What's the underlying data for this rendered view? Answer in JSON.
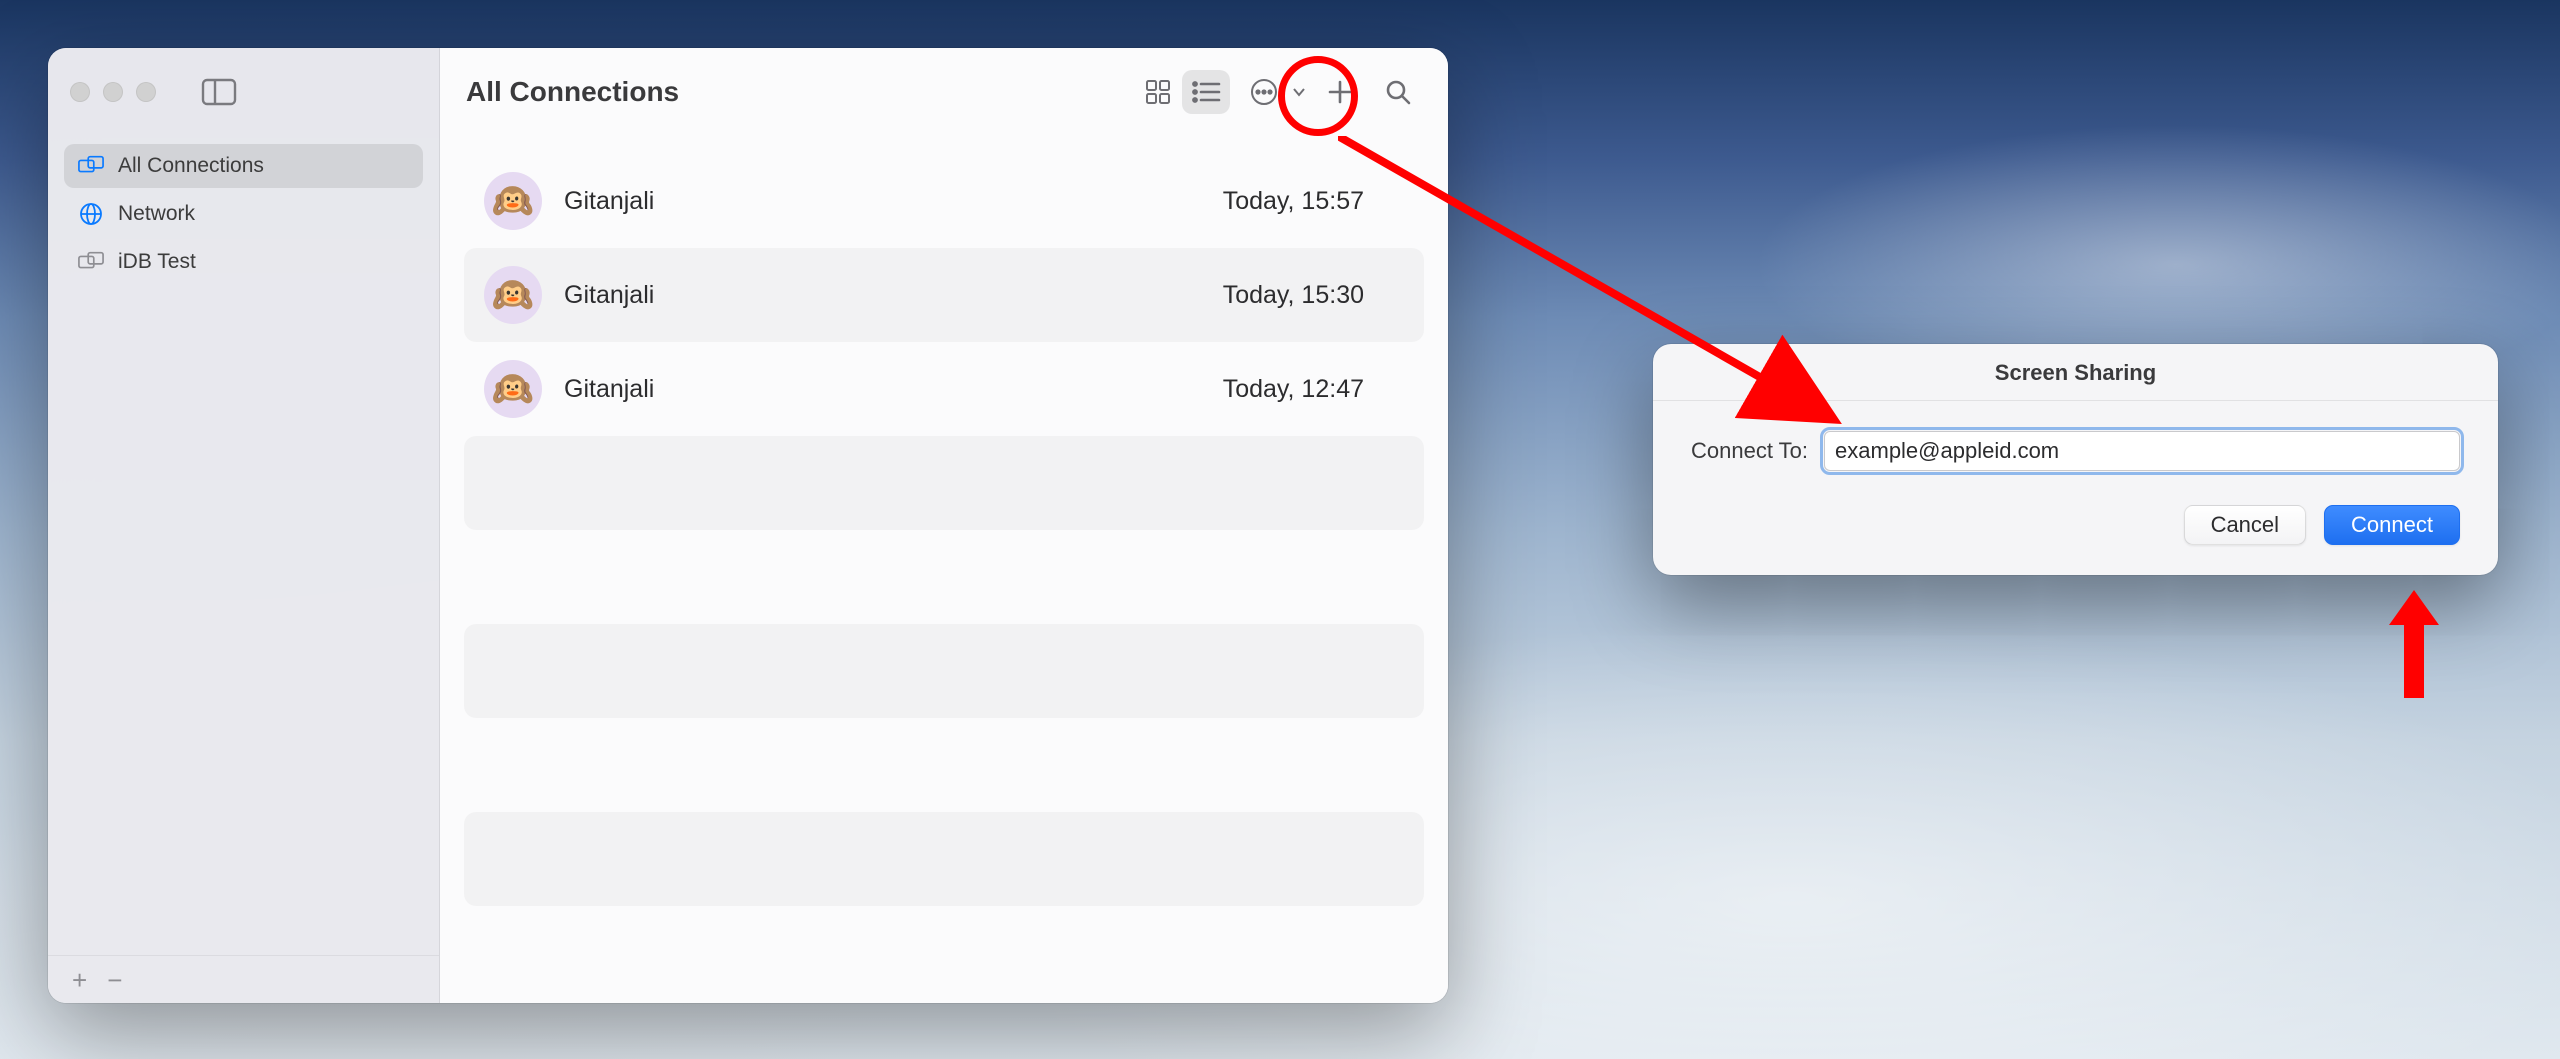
{
  "window": {
    "title": "All Connections",
    "sidebar": {
      "items": [
        {
          "label": "All Connections",
          "icon": "displays-icon",
          "selected": true
        },
        {
          "label": "Network",
          "icon": "globe-icon",
          "selected": false
        },
        {
          "label": "iDB Test",
          "icon": "displays-icon",
          "selected": false
        }
      ],
      "footer": {
        "add": "+",
        "remove": "−"
      }
    },
    "toolbar": {
      "view_grid": "grid",
      "view_list": "list",
      "more": "ellipsis",
      "add": "+",
      "search": "search"
    },
    "connections": [
      {
        "name": "Gitanjali",
        "time": "Today, 15:57",
        "avatar": "🙉"
      },
      {
        "name": "Gitanjali",
        "time": "Today, 15:30",
        "avatar": "🙉"
      },
      {
        "name": "Gitanjali",
        "time": "Today, 12:47",
        "avatar": "🙉"
      }
    ]
  },
  "dialog": {
    "title": "Screen Sharing",
    "label": "Connect To:",
    "value": "example@appleid.com",
    "cancel": "Cancel",
    "connect": "Connect"
  }
}
